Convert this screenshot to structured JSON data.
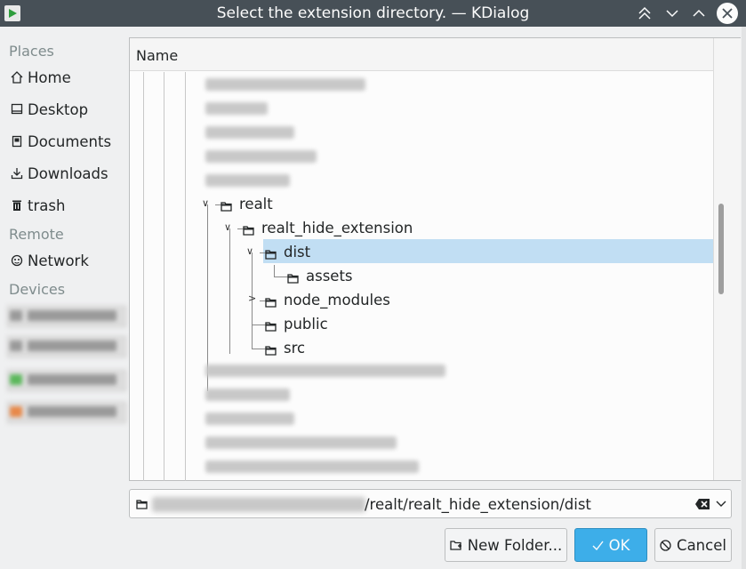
{
  "window": {
    "title": "Select the extension directory. — KDialog"
  },
  "places": {
    "places_header": "Places",
    "remote_header": "Remote",
    "devices_header": "Devices",
    "items": [
      {
        "label": "Home",
        "icon": "home-icon"
      },
      {
        "label": "Desktop",
        "icon": "desktop-icon"
      },
      {
        "label": "Documents",
        "icon": "documents-icon"
      },
      {
        "label": "Downloads",
        "icon": "downloads-icon"
      },
      {
        "label": "trash",
        "icon": "trash-icon"
      }
    ],
    "remote_items": [
      {
        "label": "Network",
        "icon": "network-icon"
      }
    ]
  },
  "filelist": {
    "column_name": "Name",
    "tree": [
      {
        "label": "realt",
        "expanded": true
      },
      {
        "label": "realt_hide_extension",
        "expanded": true
      },
      {
        "label": "dist",
        "expanded": true,
        "selected": true
      },
      {
        "label": "assets"
      },
      {
        "label": "node_modules",
        "expanded": false
      },
      {
        "label": "public"
      },
      {
        "label": "src"
      }
    ]
  },
  "pathbar": {
    "visible_path": "/realt/realt_hide_extension/dist"
  },
  "buttons": {
    "new_folder": "New Folder...",
    "ok": "OK",
    "cancel": "Cancel"
  },
  "colors": {
    "titlebar": "#475057",
    "selection": "#c1def3",
    "accent": "#3daee9"
  }
}
